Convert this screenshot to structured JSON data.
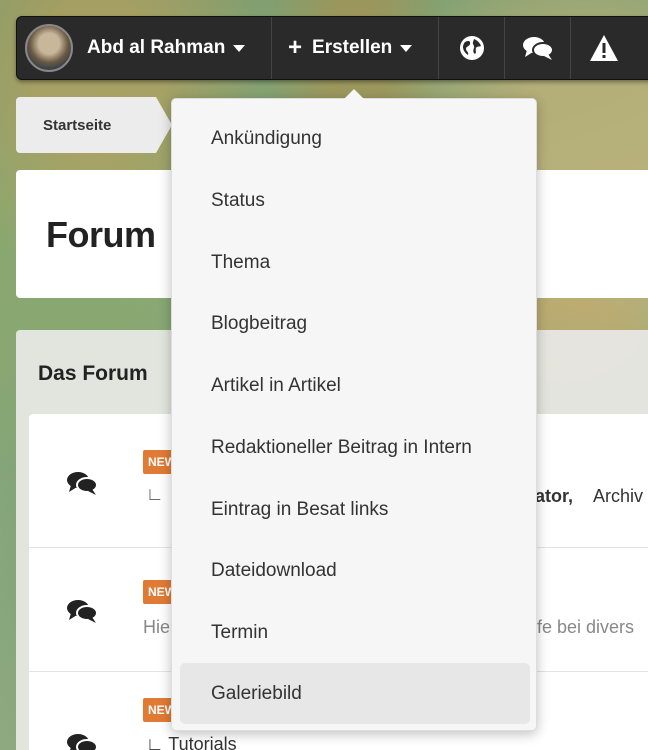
{
  "topbar": {
    "user_name": "Abd al Rahman",
    "create_label": "Erstellen",
    "icons": [
      "globe-icon",
      "chat-bubbles-icon",
      "warning-icon"
    ]
  },
  "breadcrumb": {
    "home": "Startseite"
  },
  "page": {
    "title": "Forum"
  },
  "forum_section": {
    "title": "Das Forum",
    "rows": [
      {
        "badge": "NEW",
        "subforum_prefix": "∟",
        "right_bold": "ator,",
        "right_text": "Archiv"
      },
      {
        "badge": "NEW",
        "desc_left": "Hie",
        "desc_right": "fe bei divers"
      },
      {
        "badge": "NEW",
        "subforum": "∟ Tutorials"
      }
    ]
  },
  "create_menu": {
    "items": [
      {
        "label": "Ankündigung"
      },
      {
        "label": "Status"
      },
      {
        "label": "Thema"
      },
      {
        "label": "Blogbeitrag"
      },
      {
        "label": "Artikel in Artikel"
      },
      {
        "label": "Redaktioneller Beitrag in Intern"
      },
      {
        "label": "Eintrag in Besat links"
      },
      {
        "label": "Dateidownload"
      },
      {
        "label": "Termin"
      },
      {
        "label": "Galeriebild"
      }
    ],
    "highlighted": "Galeriebild"
  },
  "colors": {
    "topbar": "#2a2a2a",
    "badge": "#e07b35",
    "menu_bg": "#f6f6f6",
    "menu_hover": "#e7e7e7"
  }
}
